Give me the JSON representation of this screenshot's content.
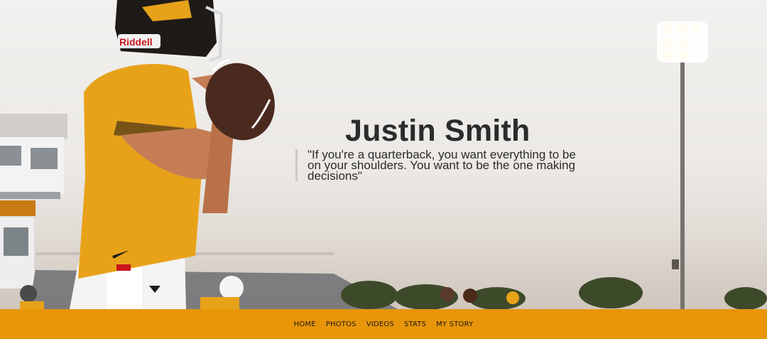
{
  "hero": {
    "title": "Justin Smith",
    "quote": "\"If you're a quarterback, you want everything to be on your shoulders. You want to be the one making decisions\"",
    "image": "quarterback-photo",
    "helmet_text": "Riddell"
  },
  "nav": {
    "items": [
      {
        "label": "HOME"
      },
      {
        "label": "PHOTOS"
      },
      {
        "label": "VIDEOS"
      },
      {
        "label": "STATS"
      },
      {
        "label": "MY STORY"
      }
    ]
  },
  "colors": {
    "accent": "#e8950a",
    "text": "#2b2b2b",
    "jersey": "#e8a21a"
  }
}
